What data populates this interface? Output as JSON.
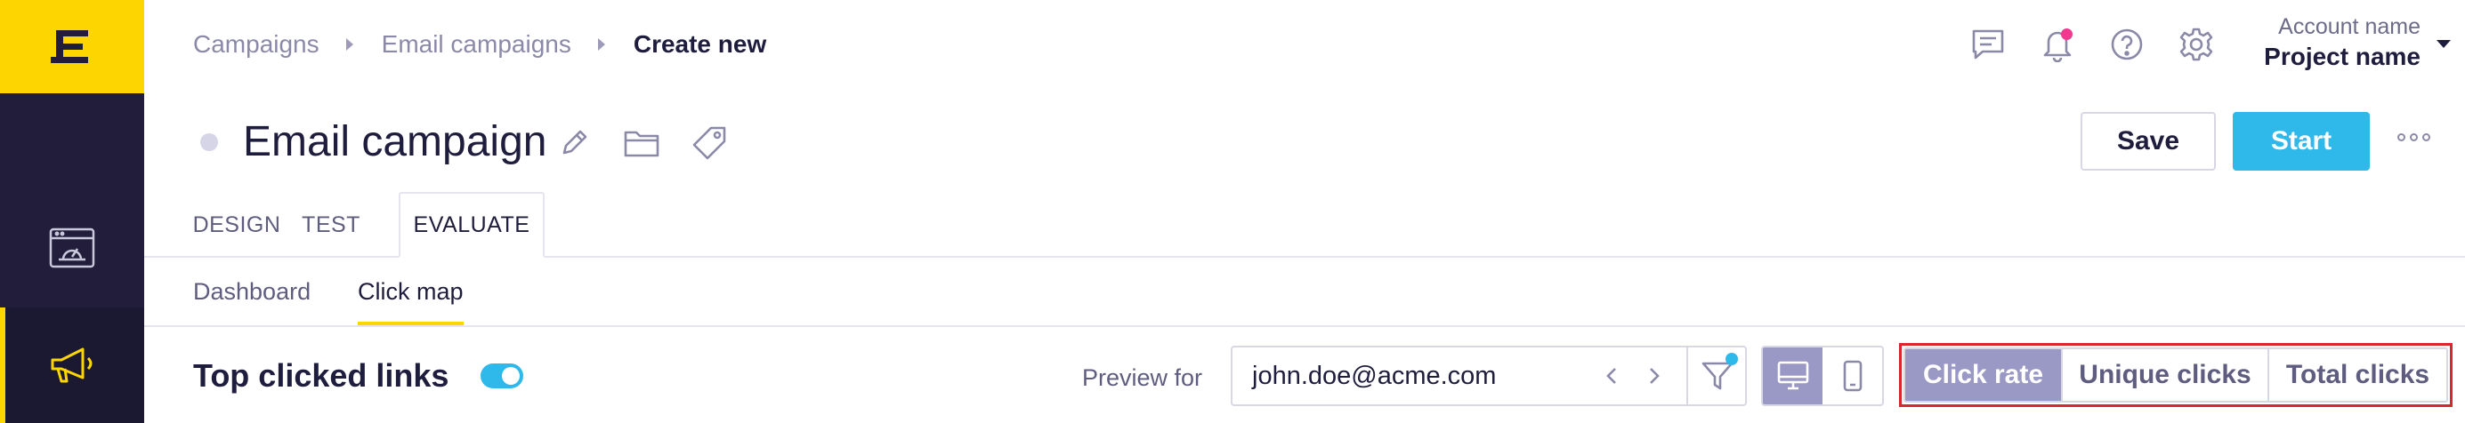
{
  "app": {
    "logo_icon": "brand-logo-icon",
    "nav_items": [
      {
        "icon": "dashboard-icon",
        "active": false
      },
      {
        "icon": "megaphone-icon",
        "active": true
      }
    ]
  },
  "breadcrumb": {
    "items": [
      "Campaigns",
      "Email campaigns",
      "Create new"
    ]
  },
  "header": {
    "icons": [
      "chat-icon",
      "bell-icon",
      "help-icon",
      "gear-icon"
    ],
    "account_name": "Account name",
    "project_name": "Project name"
  },
  "campaign": {
    "title": "Email campaign",
    "actions": {
      "save": "Save",
      "start": "Start"
    }
  },
  "tabs": [
    {
      "label": "DESIGN",
      "active": false
    },
    {
      "label": "TEST",
      "active": false
    },
    {
      "label": "EVALUATE",
      "active": true
    }
  ],
  "subtabs": [
    {
      "label": "Dashboard",
      "active": false
    },
    {
      "label": "Click map",
      "active": true
    }
  ],
  "toolbar": {
    "section_title": "Top clicked links",
    "toggle_on": true,
    "preview_label": "Preview for",
    "preview_value": "john.doe@acme.com",
    "device_modes": [
      "desktop-icon",
      "mobile-icon"
    ],
    "active_device": "desktop",
    "metrics": [
      {
        "label": "Click rate",
        "active": true
      },
      {
        "label": "Unique clicks",
        "active": false
      },
      {
        "label": "Total clicks",
        "active": false
      }
    ]
  },
  "colors": {
    "brand_yellow": "#fdd602",
    "sidebar": "#211d3b",
    "accent_blue": "#2fb8ea",
    "active_segment": "#9a98c4",
    "notification": "#f2388f",
    "highlight_border": "#d9262f"
  }
}
